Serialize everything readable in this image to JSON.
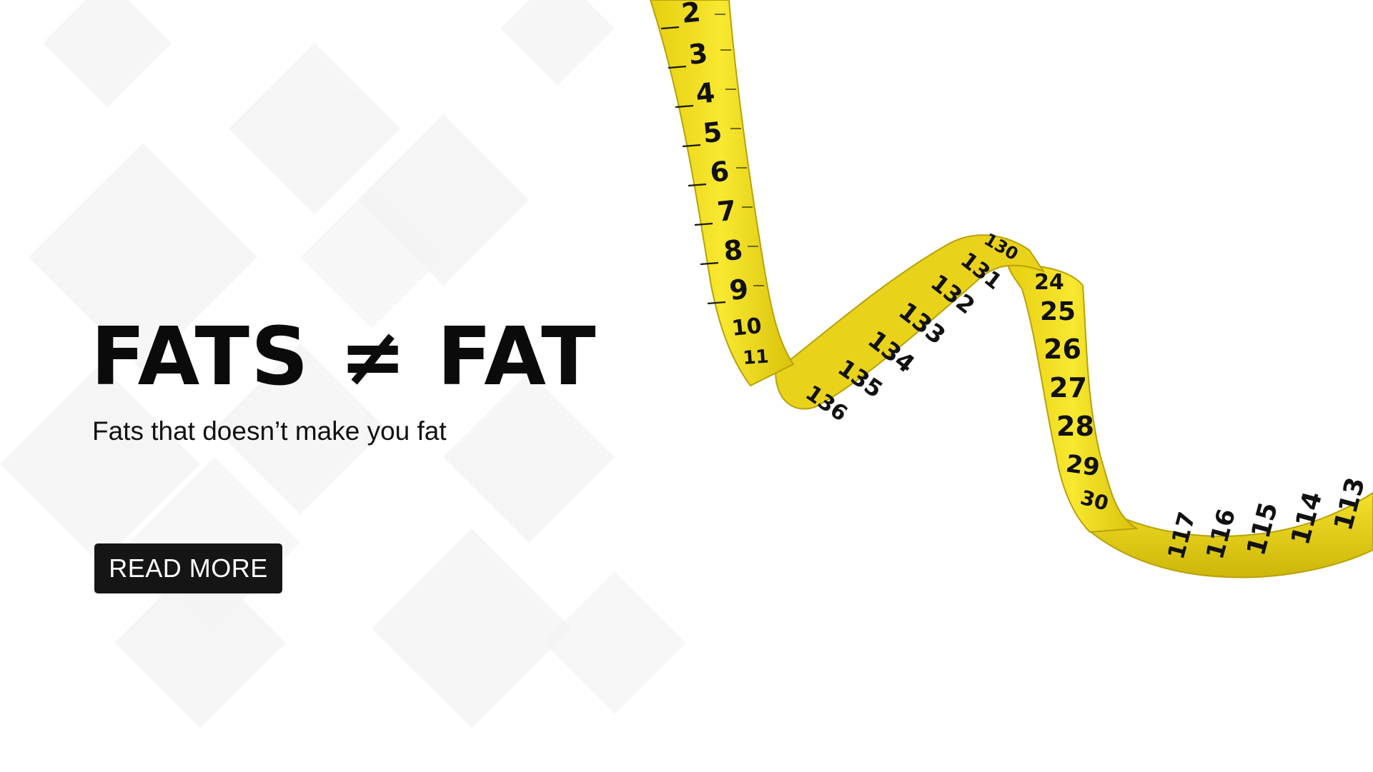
{
  "hero": {
    "headline": "FATS ≠ FAT",
    "subheadline": "Fats that doesn’t make you fat",
    "cta_label": "READ MORE"
  },
  "tape": {
    "upper_strip_numbers": [
      "2",
      "3",
      "4",
      "5",
      "6",
      "7",
      "8",
      "9",
      "10",
      "11"
    ],
    "back_loop_numbers": [
      "136",
      "135",
      "134",
      "133",
      "132",
      "131",
      "130"
    ],
    "right_strip_numbers": [
      "24",
      "25",
      "26",
      "27",
      "28",
      "29",
      "30"
    ],
    "bottom_strip_numbers": [
      "117",
      "116",
      "115",
      "114",
      "113"
    ]
  },
  "colors": {
    "background": "#ffffff",
    "text": "#0b0b0b",
    "button_bg": "#151515",
    "button_text": "#ffffff",
    "tape_yellow": "#f2df1e",
    "tape_shadow": "#c9b40a"
  }
}
